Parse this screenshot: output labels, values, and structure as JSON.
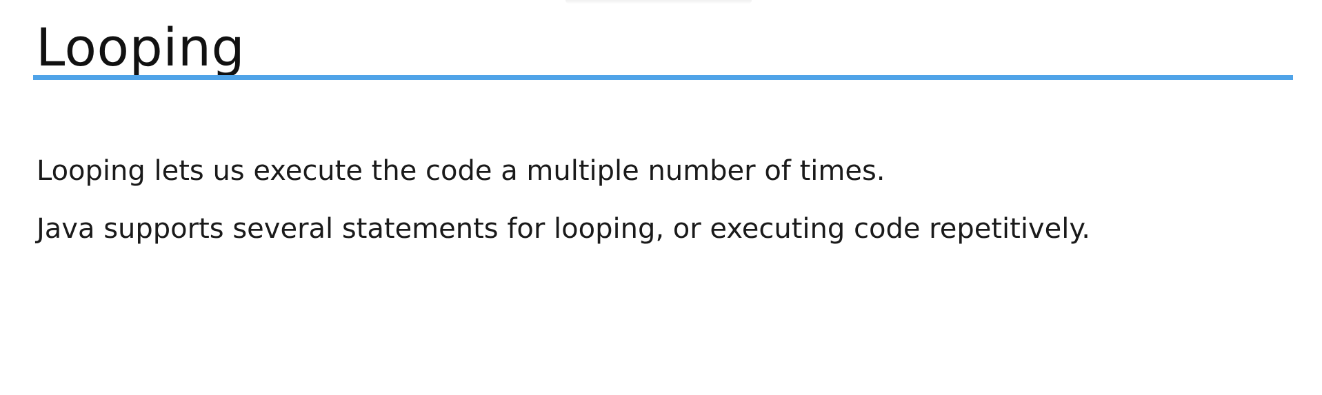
{
  "slide": {
    "title": "Looping",
    "accent_color": "#4fa3e8",
    "paragraphs": [
      "Looping lets us execute the code a multiple number of times.",
      "Java supports several statements for looping, or executing code repetitively."
    ]
  }
}
